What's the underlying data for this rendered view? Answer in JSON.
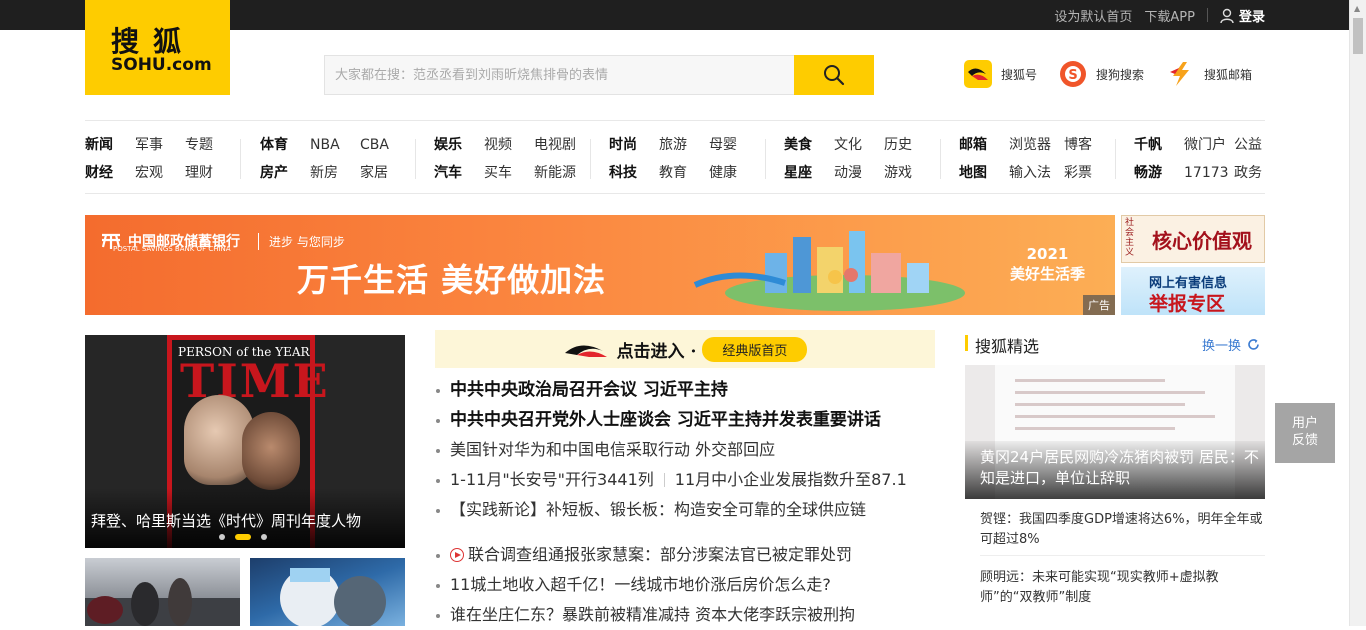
{
  "topbar": {
    "set_home": "设为默认首页",
    "download_app": "下载APP",
    "login": "登录"
  },
  "logo": {
    "cn": "搜狐",
    "en": "SOHU.com"
  },
  "search": {
    "placeholder": "大家都在搜：范丞丞看到刘雨昕烧焦排骨的表情"
  },
  "quick_links": [
    {
      "label": "搜狐号",
      "icon": "sohu-account-icon"
    },
    {
      "label": "搜狗搜索",
      "icon": "sogou-search-icon"
    },
    {
      "label": "搜狐邮箱",
      "icon": "sohu-mail-icon"
    }
  ],
  "nav": [
    {
      "row1": [
        "新闻",
        "军事",
        "专题"
      ],
      "row2": [
        "财经",
        "宏观",
        "理财"
      ]
    },
    {
      "row1": [
        "体育",
        "NBA",
        "CBA"
      ],
      "row2": [
        "房产",
        "新房",
        "家居"
      ]
    },
    {
      "row1": [
        "娱乐",
        "视频",
        "电视剧"
      ],
      "row2": [
        "汽车",
        "买车",
        "新能源"
      ]
    },
    {
      "row1": [
        "时尚",
        "旅游",
        "母婴"
      ],
      "row2": [
        "科技",
        "教育",
        "健康"
      ]
    },
    {
      "row1": [
        "美食",
        "文化",
        "历史"
      ],
      "row2": [
        "星座",
        "动漫",
        "游戏"
      ]
    },
    {
      "row1": [
        "邮箱",
        "浏览器",
        "博客"
      ],
      "row2": [
        "地图",
        "输入法",
        "彩票"
      ]
    },
    {
      "row1": [
        "千帆",
        "微门户",
        "公益"
      ],
      "row2": [
        "畅游",
        "17173",
        "政务"
      ]
    }
  ],
  "banner": {
    "bank_name": "中国邮政储蓄银行",
    "bank_en": "POSTAL SAVINGS BANK OF CHINA",
    "slogan": "进步 与您同步",
    "headline": "万千生活 美好做加法",
    "year_text": "2021",
    "season": "美好生活季",
    "ad_label": "广告"
  },
  "side_ads": {
    "ad1_vertical": "社会主义",
    "ad1_title": "核心价值观",
    "ad2_line1": "网上有害信息",
    "ad2_line2": "举报专区"
  },
  "focus": {
    "cover_header": "PERSON of the YEAR",
    "cover_title": "TIME",
    "caption": "拜登、哈里斯当选《时代》周刊年度人物"
  },
  "enter": {
    "text": "点击进入 ·",
    "pill": "经典版首页"
  },
  "news_group1": [
    {
      "text": "中共中央政治局召开会议 习近平主持",
      "bold": true
    },
    {
      "text": "中共中央召开党外人士座谈会 习近平主持并发表重要讲话",
      "bold": true
    },
    {
      "text": "美国针对华为和中国电信采取行动 外交部回应",
      "bold": false
    },
    {
      "text": "1-11月\"长安号\"开行3441列",
      "text2": "11月中小企业发展指数升至87.1",
      "bold": false
    },
    {
      "text": "【实践新论】补短板、锻长板：构造安全可靠的全球供应链",
      "bold": false
    }
  ],
  "news_group2": [
    {
      "text": "联合调查组通报张家慧案：部分涉案法官已被定罪处罚",
      "video": true
    },
    {
      "text": "11城土地收入超千亿！一线城市地价涨后房价怎么走?"
    },
    {
      "text": "谁在坐庄仁东？暴跌前被精准减持 资本大佬李跃宗被刑拘"
    }
  ],
  "picks": {
    "title": "搜狐精选",
    "refresh": "换一换",
    "image_caption": "黄冈24户居民网购冷冻猪肉被罚 居民：不知是进口，单位让辞职",
    "items": [
      "贺铿：我国四季度GDP增速将达6%，明年全年或可超过8%",
      "顾明远：未来可能实现“现实教师+虚拟教师”的“双教师”制度"
    ]
  },
  "feedback": {
    "line1": "用户",
    "line2": "反馈"
  }
}
